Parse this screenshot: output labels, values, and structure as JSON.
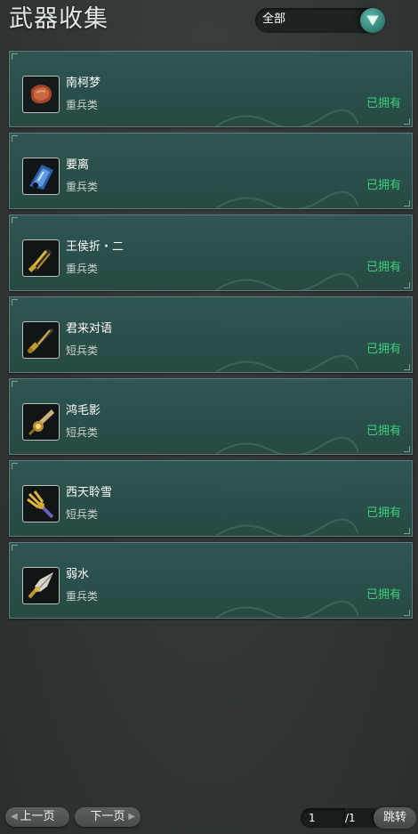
{
  "header": {
    "title": "武器收集",
    "filter": {
      "selected": "全部",
      "icon": "chevron-down-icon"
    }
  },
  "weapons": [
    {
      "name": "南柯梦",
      "type": "重兵类",
      "status": "已拥有",
      "icon": "meat-cleaver-icon"
    },
    {
      "name": "要离",
      "type": "重兵类",
      "status": "已拥有",
      "icon": "blue-axe-icon"
    },
    {
      "name": "王侯折・二",
      "type": "重兵类",
      "status": "已拥有",
      "icon": "gold-blade-icon"
    },
    {
      "name": "君来对语",
      "type": "短兵类",
      "status": "已拥有",
      "icon": "dagger-icon"
    },
    {
      "name": "鸿毛影",
      "type": "短兵类",
      "status": "已拥有",
      "icon": "ornate-dagger-icon"
    },
    {
      "name": "西天聆雪",
      "type": "短兵类",
      "status": "已拥有",
      "icon": "trident-icon"
    },
    {
      "name": "弱水",
      "type": "重兵类",
      "status": "已拥有",
      "icon": "spearhead-icon"
    }
  ],
  "footer": {
    "prev_label": "上一页",
    "next_label": "下一页",
    "current_page": "1",
    "total_pages": "/1",
    "jump_label": "跳转"
  },
  "colors": {
    "card_bg": "#2c524d",
    "owned_text": "#3ad07a",
    "page_bg": "#343838"
  }
}
